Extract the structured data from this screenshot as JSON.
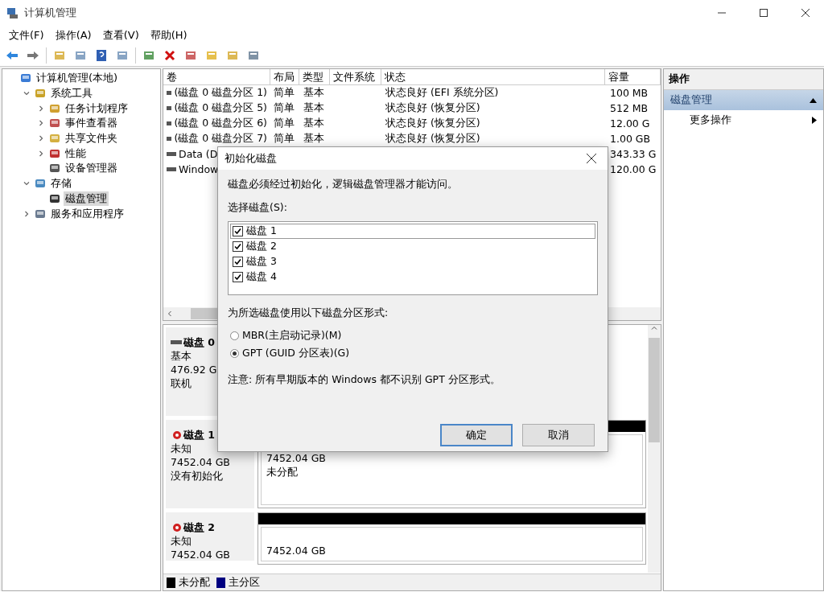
{
  "window": {
    "title": "计算机管理"
  },
  "menu": [
    "文件(F)",
    "操作(A)",
    "查看(V)",
    "帮助(H)"
  ],
  "tree": [
    {
      "label": "计算机管理(本地)",
      "selected": false,
      "children": [
        {
          "label": "系统工具",
          "expanded": true,
          "selected": false,
          "children": [
            {
              "label": "任务计划程序",
              "expanded": false,
              "selected": false
            },
            {
              "label": "事件查看器",
              "expanded": false,
              "selected": false
            },
            {
              "label": "共享文件夹",
              "expanded": false,
              "selected": false
            },
            {
              "label": "性能",
              "expanded": false,
              "selected": false
            },
            {
              "label": "设备管理器",
              "selected": false
            }
          ]
        },
        {
          "label": "存储",
          "expanded": true,
          "selected": false,
          "children": [
            {
              "label": "磁盘管理",
              "selected": true
            }
          ]
        },
        {
          "label": "服务和应用程序",
          "expanded": false,
          "selected": false
        }
      ]
    }
  ],
  "table": {
    "columns": [
      "卷",
      "布局",
      "类型",
      "文件系统",
      "状态",
      "容量"
    ],
    "rows": [
      {
        "cells": [
          "(磁盘 0 磁盘分区 1)",
          "简单",
          "基本",
          "",
          "状态良好 (EFI 系统分区)",
          "100 MB"
        ]
      },
      {
        "cells": [
          "(磁盘 0 磁盘分区 5)",
          "简单",
          "基本",
          "",
          "状态良好 (恢复分区)",
          "512 MB"
        ]
      },
      {
        "cells": [
          "(磁盘 0 磁盘分区 6)",
          "简单",
          "基本",
          "",
          "状态良好 (恢复分区)",
          "12.00 G"
        ]
      },
      {
        "cells": [
          "(磁盘 0 磁盘分区 7)",
          "简单",
          "基本",
          "",
          "状态良好 (恢复分区)",
          "1.00 GB"
        ]
      },
      {
        "cells": [
          "Data (D",
          "",
          "",
          "",
          "",
          "343.33 G"
        ]
      },
      {
        "cells": [
          "Window",
          "",
          "",
          "",
          "",
          "120.00 G"
        ]
      }
    ]
  },
  "disks": [
    {
      "name": "磁盘 0",
      "kind": "online",
      "lines": [
        "基本",
        "476.92 G",
        "联机"
      ]
    },
    {
      "name": "磁盘 1",
      "kind": "error",
      "lines": [
        "未知",
        "7452.04 GB",
        "没有初始化"
      ],
      "partitions": [
        {
          "size": "7452.04 GB",
          "label": "未分配",
          "color": "#000000"
        }
      ]
    },
    {
      "name": "磁盘 2",
      "kind": "error",
      "lines": [
        "未知",
        "7452.04 GB"
      ],
      "partitions": [
        {
          "size": "7452.04 GB",
          "color": "#000000"
        }
      ]
    }
  ],
  "legend": [
    {
      "label": "未分配",
      "color": "#000000"
    },
    {
      "label": "主分区",
      "color": "#000080"
    }
  ],
  "actions": {
    "title": "操作",
    "section": "磁盘管理",
    "items": [
      "更多操作"
    ]
  },
  "dialog": {
    "title": "初始化磁盘",
    "message": "磁盘必须经过初始化，逻辑磁盘管理器才能访问。",
    "list_label": "选择磁盘(S):",
    "disks": [
      {
        "label": "磁盘 1",
        "checked": true,
        "selected": true
      },
      {
        "label": "磁盘 2",
        "checked": true,
        "selected": false
      },
      {
        "label": "磁盘 3",
        "checked": true,
        "selected": false
      },
      {
        "label": "磁盘 4",
        "checked": true,
        "selected": false
      }
    ],
    "style_label": "为所选磁盘使用以下磁盘分区形式:",
    "options": [
      {
        "label": "MBR(主启动记录)(M)",
        "selected": false
      },
      {
        "label": "GPT (GUID 分区表)(G)",
        "selected": true
      }
    ],
    "note": "注意: 所有早期版本的 Windows 都不识别 GPT 分区形式。",
    "buttons": [
      {
        "label": "确定",
        "default": true
      },
      {
        "label": "取消",
        "default": false
      }
    ]
  }
}
